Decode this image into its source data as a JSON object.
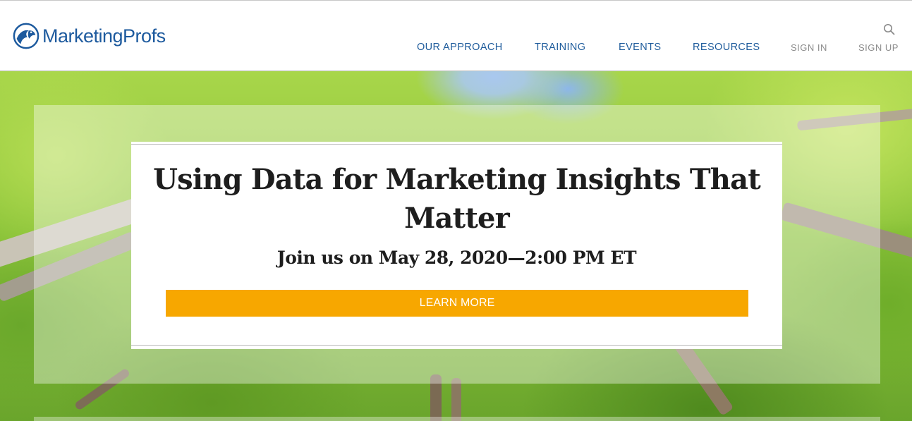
{
  "header": {
    "logo_text": "MarketingProfs",
    "nav": {
      "approach": "OUR APPROACH",
      "training": "TRAINING",
      "events": "EVENTS",
      "resources": "RESOURCES",
      "sign_in": "SIGN IN",
      "sign_up": "SIGN UP"
    },
    "search_icon": "search-icon"
  },
  "hero": {
    "title": "Using Data for Marketing Insights That Matter",
    "subtitle": "Join us on May 28, 2020—2:00 PM ET",
    "cta_label": "LEARN MORE"
  },
  "colors": {
    "brand_blue": "#1d5a9e",
    "nav_blue": "#1f5c9c",
    "nav_muted": "#8c8c8c",
    "cta_orange": "#f7a700",
    "heading_text": "#1e1e1e"
  }
}
